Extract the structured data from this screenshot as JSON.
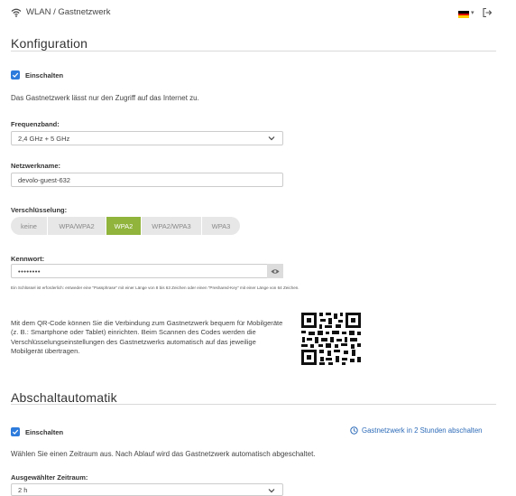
{
  "header": {
    "breadcrumb": "WLAN / Gastnetzwerk",
    "wifi_icon": "wifi-icon",
    "flag_colors": [
      "#000000",
      "#dd0000",
      "#ffce00"
    ],
    "logout_icon": "logout-icon"
  },
  "config": {
    "title": "Konfiguration",
    "enable_label": "Einschalten",
    "description": "Das Gastnetzwerk lässt nur den Zugriff auf das Internet zu.",
    "band_label": "Frequenzband:",
    "band_value": "2,4 GHz + 5 GHz",
    "name_label": "Netzwerkname:",
    "name_value": "devolo-guest-632",
    "encryption_label": "Verschlüsselung:",
    "encryption_options": [
      "keine",
      "WPA/WPA2",
      "WPA2",
      "WPA2/WPA3",
      "WPA3"
    ],
    "encryption_selected": "WPA2",
    "password_label": "Kennwort:",
    "password_value": "••••••••",
    "password_hint": "Ein Schlüssel ist erforderlich: entweder eine \"Passphrase\" mit einer Länge von 8 bis 63 Zeichen oder einen \"Preshared-Key\" mit einer Länge von 64 Zeichen.",
    "qr_text": "Mit dem QR-Code können Sie die Verbindung zum Gastnetzwerk bequem für Mobilgeräte (z. B.: Smartphone oder Tablet) einrichten. Beim Scannen des Codes werden die Verschlüsselungseinstellungen des Gastnetzwerks automatisch auf das jeweilige Mobilgerät übertragen."
  },
  "auto_off": {
    "title": "Abschaltautomatik",
    "enable_label": "Einschalten",
    "status": "Gastnetzwerk in 2 Stunden abschalten",
    "description": "Wählen Sie einen Zeitraum aus. Nach Ablauf wird das Gastnetzwerk automatisch abgeschaltet.",
    "period_label": "Ausgewählter Zeitraum:",
    "period_value": "2 h"
  },
  "colors": {
    "accent_blue": "#2d7bdc",
    "active_green": "#90b43c",
    "link_blue": "#2d6bb8"
  }
}
